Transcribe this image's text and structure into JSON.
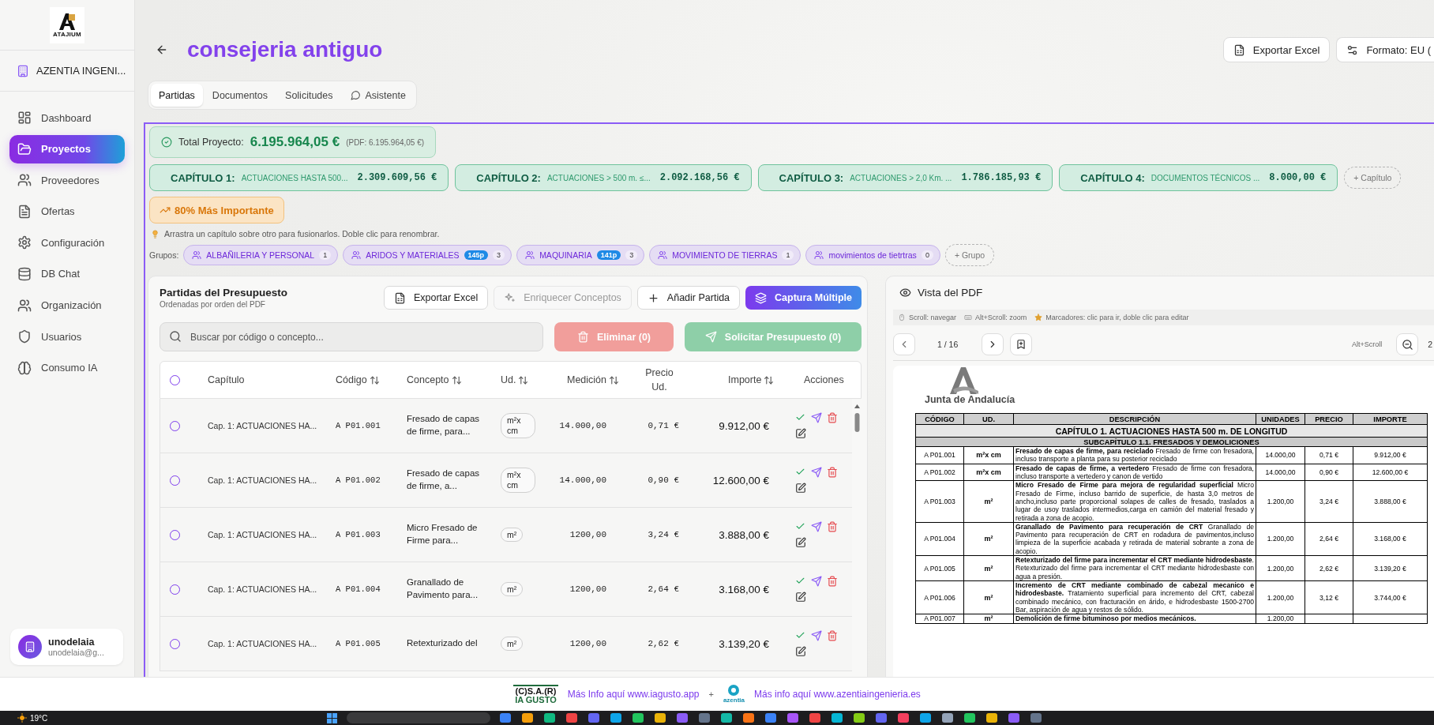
{
  "sidebar": {
    "logo_text": "ATAJIUM",
    "organization": "AZENTIA INGENI...",
    "items": [
      {
        "label": "Dashboard",
        "selected": false
      },
      {
        "label": "Proyectos",
        "selected": true
      },
      {
        "label": "Proveedores",
        "selected": false
      },
      {
        "label": "Ofertas",
        "selected": false
      },
      {
        "label": "Configuración",
        "selected": false
      },
      {
        "label": "DB Chat",
        "selected": false
      },
      {
        "label": "Organización",
        "selected": false
      },
      {
        "label": "Usuarios",
        "selected": false
      },
      {
        "label": "Consumo IA",
        "selected": false
      }
    ],
    "user": {
      "name": "unodelaia",
      "email": "unodelaia@g..."
    }
  },
  "header": {
    "title": "consejeria antiguo",
    "actions": [
      "Exportar Excel",
      "Formato: EU ("
    ]
  },
  "tabs": [
    {
      "label": "Partidas",
      "selected": true
    },
    {
      "label": "Documentos",
      "selected": false
    },
    {
      "label": "Solicitudes",
      "selected": false
    },
    {
      "label": "Asistente",
      "selected": false
    }
  ],
  "total": {
    "label": "Total Proyecto:",
    "amount": "6.195.964,05 €",
    "pdf_amount": "(PDF: 6.195.964,05 €)"
  },
  "chapters": [
    {
      "title": "CAPÍTULO 1:",
      "description": "ACTUACIONES HASTA 500...",
      "amount": "2.309.609,56 €"
    },
    {
      "title": "CAPÍTULO 2:",
      "description": "ACTUACIONES > 500 m. ≤...",
      "amount": "2.092.168,56 €"
    },
    {
      "title": "CAPÍTULO 3:",
      "description": "ACTUACIONES > 2,0 Km. ...",
      "amount": "1.786.185,93 €"
    },
    {
      "title": "CAPÍTULO 4:",
      "description": "DOCUMENTOS TÉCNICOS ...",
      "amount": "8.000,00 €"
    }
  ],
  "add_chapter": "+ Capítulo",
  "highlight": "80% Más Importante",
  "hint": "Arrastra un capítulo sobre otro para fusionarlos. Doble clic para renombrar.",
  "groups": {
    "label": "Grupos:",
    "items": [
      {
        "name": "ALBAÑILERIA Y PERSONAL",
        "count": "1"
      },
      {
        "name": "ARIDOS Y MATERIALES",
        "badge": "145p",
        "count": "3"
      },
      {
        "name": "MAQUINARIA",
        "badge": "141p",
        "count": "3"
      },
      {
        "name": "MOVIMIENTO DE TIERRAS",
        "count": "1"
      },
      {
        "name": "movimientos de tietrtras",
        "count": "0"
      }
    ],
    "add": "+ Grupo"
  },
  "partidas": {
    "title": "Partidas del Presupuesto",
    "subtitle": "Ordenadas por orden del PDF",
    "buttons": [
      {
        "label": "Exportar Excel",
        "kind": "outline",
        "disabled": false
      },
      {
        "label": "Enriquecer Conceptos",
        "kind": "outline",
        "disabled": true
      },
      {
        "label": "Añadir Partida",
        "kind": "outline",
        "disabled": false
      },
      {
        "label": "Captura Múltiple",
        "kind": "primary",
        "disabled": false
      }
    ],
    "search": {
      "placeholder": "Buscar por código o concepto..."
    },
    "bulk_buttons": [
      {
        "label": "Eliminar (0)",
        "kind": "danger",
        "disabled": true
      },
      {
        "label": "Solicitar Presupuesto (0)",
        "kind": "success",
        "disabled": true
      }
    ],
    "table": {
      "all_selected": false,
      "columns": [
        {
          "label": "Capítulo",
          "sortable": false
        },
        {
          "label": "Código",
          "sortable": true
        },
        {
          "label": "Concepto",
          "sortable": true
        },
        {
          "label": "Ud.",
          "sortable": true
        },
        {
          "label": "Medición",
          "sortable": true
        },
        {
          "label": "Precio Ud.",
          "sortable": false
        },
        {
          "label": "Importe",
          "sortable": true
        },
        {
          "label": "Acciones",
          "sortable": false
        }
      ],
      "rows": [
        {
          "selected": false,
          "chapter": "Cap. 1: ACTUACIONES HA...",
          "code": "A P01.001",
          "concept": "Fresado de capas de firme, para...",
          "unit": "m²x cm",
          "measure": "14.000,00",
          "price": "0,71 €",
          "amount": "9.912,00 €"
        },
        {
          "selected": false,
          "chapter": "Cap. 1: ACTUACIONES HA...",
          "code": "A P01.002",
          "concept": "Fresado de capas de firme, a...",
          "unit": "m²x cm",
          "measure": "14.000,00",
          "price": "0,90 €",
          "amount": "12.600,00 €"
        },
        {
          "selected": false,
          "chapter": "Cap. 1: ACTUACIONES HA...",
          "code": "A P01.003",
          "concept": "Micro Fresado de Firme para...",
          "unit": "m²",
          "measure": "1200,00",
          "price": "3,24 €",
          "amount": "3.888,00 €"
        },
        {
          "selected": false,
          "chapter": "Cap. 1: ACTUACIONES HA...",
          "code": "A P01.004",
          "concept": "Granallado de Pavimento para...",
          "unit": "m²",
          "measure": "1200,00",
          "price": "2,64 €",
          "amount": "3.168,00 €"
        },
        {
          "selected": false,
          "chapter": "Cap. 1: ACTUACIONES HA...",
          "code": "A P01.005",
          "concept": "Retexturizado del",
          "unit": "m²",
          "measure": "1200,00",
          "price": "2,62 €",
          "amount": "3.139,20 €"
        }
      ]
    }
  },
  "pdf_view": {
    "title": "Vista del PDF",
    "hints": [
      "Scroll: navegar",
      "Alt+Scroll: zoom",
      "Marcadores: clic para ir, doble clic para editar"
    ],
    "page": "1 / 16",
    "zoom_hint": "Alt+Scroll",
    "zoom_level": "2",
    "document": {
      "logo_text": "Junta de Andalucía",
      "columns": [
        "CÓDIGO",
        "UD.",
        "DESCRIPCIÓN",
        "UNIDADES",
        "PRECIO",
        "IMPORTE"
      ],
      "chapter": "CAPÍTULO 1. ACTUACIONES HASTA 500 m. DE LONGITUD",
      "subchapter": "SUBCAPÍTULO 1.1. FRESADOS Y DEMOLICIONES",
      "rows": [
        {
          "code": "A P01.001",
          "unit": "m²x cm",
          "description": "**Fresado de capas de firme, para reciclado** Fresado de firme con fresadora, incluso transporte a planta para su posterior reciclado",
          "quantity": "14.000,00",
          "price": "0,71 €",
          "amount": "9.912,00 €"
        },
        {
          "code": "A P01.002",
          "unit": "m²x cm",
          "description": "**Fresado de capas de firme, a vertedero** Fresado de firme con fresadora, incluso transporte a vertedero y canon de vertido",
          "quantity": "14.000,00",
          "price": "0,90 €",
          "amount": "12.600,00 €"
        },
        {
          "code": "A P01.003",
          "unit": "m²",
          "description": "**Micro Fresado de Firme para mejora de regularidad superficial** Micro Fresado de Firme, incluso barrido de superficie, de hasta 3,0 metros de ancho,incluso parte proporcional solapes de calles de fresado, traslados a lugar de usoy traslados intermedios,carga en camión del material fresado y retirada a zona de acopio.",
          "quantity": "1.200,00",
          "price": "3,24 €",
          "amount": "3.888,00 €"
        },
        {
          "code": "A P01.004",
          "unit": "m²",
          "description": "**Granallado de Pavimento para recuperación de CRT** Granallado de Pavimento para recuperación de CRT en rodadura de pavimentos,incluso limpieza de la superficie acabada y retirada de material sobrante a zona de acopio.",
          "quantity": "1.200,00",
          "price": "2,64 €",
          "amount": "3.168,00 €"
        },
        {
          "code": "A P01.005",
          "unit": "m²",
          "description": "**Retexturizado del firme para incrementar el CRT mediante hidrodesbaste**. Retexturizado del firme para incrementar el CRT mediante hidrodesbaste con agua a presión.",
          "quantity": "1.200,00",
          "price": "2,62 €",
          "amount": "3.139,20 €"
        },
        {
          "code": "A P01.006",
          "unit": "m²",
          "description": "**Incremento de CRT mediante combinado de cabezal mecanico e hidrodesbaste.** Tratamiento superficial para incremento del CRT, cabezal combinado mecánico, con fracturación en árido, e hidrodesbaste 1500-2700 Bar, aspiración de agua y restos de sólido.",
          "quantity": "1.200,00",
          "price": "3,12 €",
          "amount": "3.744,00 €"
        },
        {
          "code": "A P01.007",
          "unit": "m²",
          "description": "**Demolición de firme bituminoso por medios mecánicos.**",
          "quantity": "1.200,00"
        }
      ]
    }
  },
  "footer": {
    "brand": "(C)S.A.(R)",
    "brand_sub": "IA GUSTO",
    "link1": "Más Info aquí www.iagusto.app",
    "separator": "+",
    "partner": "azentia",
    "link2": "Más info aquí www.azentiaingenieria.es"
  },
  "taskbar": {
    "weather": "19°C"
  }
}
